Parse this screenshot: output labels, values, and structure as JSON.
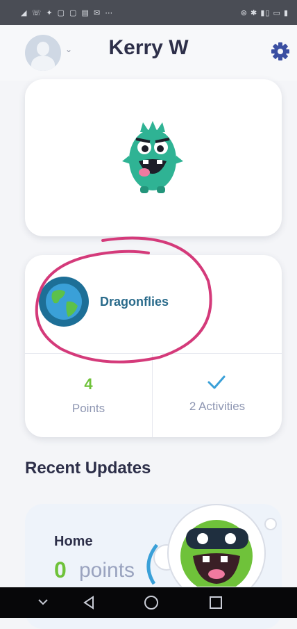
{
  "header": {
    "title": "Kerry W",
    "avatar_icon": "user-avatar-icon",
    "settings_icon": "gear-icon"
  },
  "class_card": {
    "name": "Dragonflies"
  },
  "stats": {
    "points_value": "4",
    "points_label": "Points",
    "activities_label": "2 Activities"
  },
  "recent": {
    "heading": "Recent Updates",
    "home_title": "Home",
    "home_points_value": "0",
    "home_points_word": "points"
  },
  "colors": {
    "title": "#2d2f49",
    "accent_green": "#6fc23a",
    "class_blue": "#2a6b8b",
    "gear_blue": "#3b4fa2",
    "annotation_pink": "#d43a7a"
  }
}
